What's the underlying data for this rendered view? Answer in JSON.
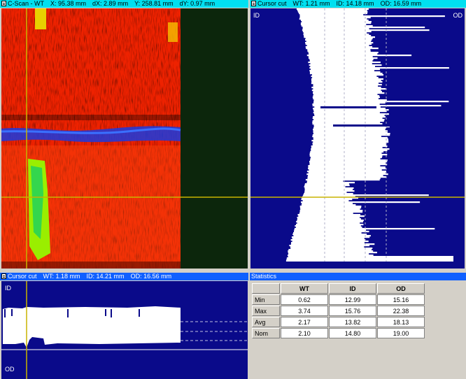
{
  "cscan": {
    "title": "C-Scan - WT",
    "x": "X: 95.38 mm",
    "dx": "dX: 2.89 mm",
    "y": "Y: 258.81 mm",
    "dy": "dY: 0.97 mm"
  },
  "cut_right": {
    "title": "Cursor cut",
    "wt": "WT: 1.21 mm",
    "id": "ID: 14.18 mm",
    "od": "OD: 16.59 mm",
    "label_id": "ID",
    "label_od": "OD"
  },
  "cut_bottom": {
    "title": "Cursor cut",
    "wt": "WT: 1.18 mm",
    "id": "ID: 14.21 mm",
    "od": "OD: 16.56 mm",
    "label_id": "ID",
    "label_od": "OD"
  },
  "stats": {
    "title": "Statistics",
    "columns": [
      "WT",
      "ID",
      "OD"
    ],
    "rows": [
      {
        "label": "Min",
        "values": [
          "0.62",
          "12.99",
          "15.16"
        ]
      },
      {
        "label": "Max",
        "values": [
          "3.74",
          "15.76",
          "22.38"
        ]
      },
      {
        "label": "Avg",
        "values": [
          "2.17",
          "13.82",
          "18.13"
        ]
      },
      {
        "label": "Nom",
        "values": [
          "2.10",
          "14.80",
          "19.00"
        ]
      }
    ]
  },
  "colors": {
    "navy": "#0a0a8a",
    "cscan_red": "#ee2200",
    "cursor_yellow": "#c8b400"
  }
}
